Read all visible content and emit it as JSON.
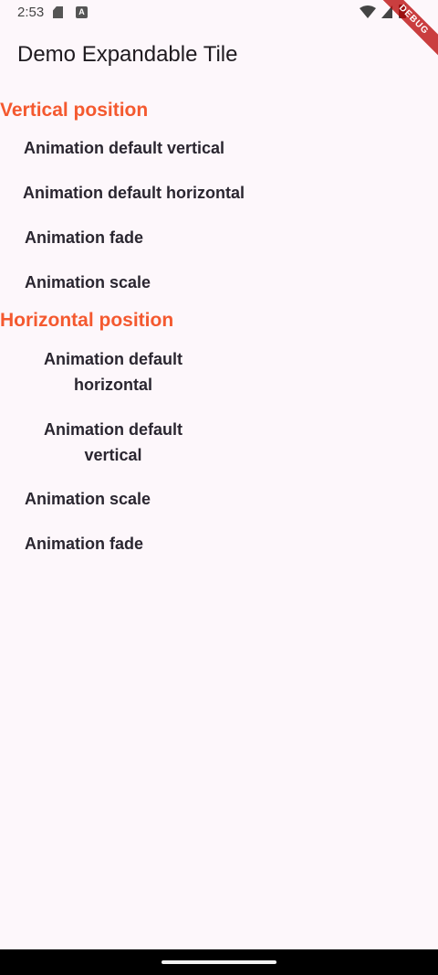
{
  "status_bar": {
    "time": "2:53",
    "a_badge": "A",
    "icons": [
      "sd-card-icon",
      "a-badge-icon",
      "wifi-icon",
      "signal-icon",
      "battery-icon"
    ]
  },
  "debug_banner": "DEBUG",
  "app_bar": {
    "title": "Demo Expandable Tile"
  },
  "sections": [
    {
      "title": "Vertical position",
      "items": [
        "Animation default vertical",
        "Animation default horizontal",
        "Animation fade",
        "Animation scale"
      ]
    },
    {
      "title": "Horizontal position",
      "items": [
        "Animation default horizontal",
        "Animation default vertical",
        "Animation scale",
        "Animation fade"
      ]
    }
  ],
  "colors": {
    "accent": "#f4592f",
    "background": "#fdf7fb",
    "text": "#2a2630"
  }
}
